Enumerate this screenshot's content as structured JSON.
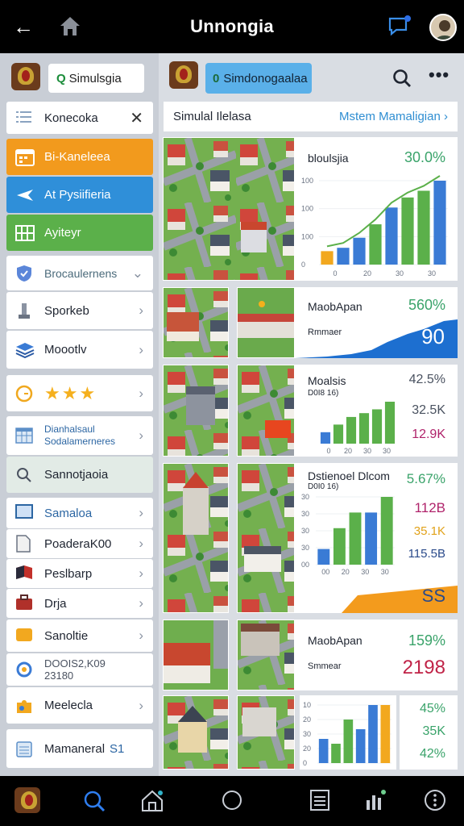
{
  "topbar": {
    "back_icon": "arrow-left-icon",
    "title": "Unnongia"
  },
  "sidebar": {
    "search_prefix": "Q",
    "search_text": "Simulsgia",
    "header_item": {
      "label": "Konecoka"
    },
    "items": [
      {
        "label": "Bi-Kaneleea",
        "color": "#f29a1d"
      },
      {
        "label": "At Pysiifieria",
        "color": "#2f8fd9"
      },
      {
        "label": "Ayiteyr",
        "color": "#5bb04a"
      },
      {
        "label": "Brocaulernens"
      },
      {
        "label": "Sporkeb"
      },
      {
        "label": "Moootlv"
      },
      {
        "label": "★★★"
      },
      {
        "label": "Dianhalsaul",
        "label2": "Sodalamerneres"
      },
      {
        "label": "Sannotjaoia"
      },
      {
        "label": "Samaloa"
      },
      {
        "label": "PoaderaK00"
      },
      {
        "label": "Peslbarp"
      },
      {
        "label": "Drja"
      },
      {
        "label": "Sanoltie"
      },
      {
        "label": "DOOIS2,K09",
        "label2": "23180"
      },
      {
        "label": "Meelecla"
      },
      {
        "label": "Mamaneral",
        "label2": "S1"
      }
    ]
  },
  "main": {
    "search_prefix": "0",
    "search_text": "Simdonogaalaa",
    "sim_bar": {
      "left": "Simulal Ilelasa",
      "right": "Mstem Mamaligian"
    },
    "cards": [
      {
        "title": "bloulsjia",
        "value": "30.0%",
        "value_color": "#3aa36a",
        "axis": [
          "100",
          "100",
          "100",
          "0"
        ],
        "xt": [
          "0",
          "20",
          "30",
          "30"
        ]
      },
      {
        "title": "MaobApan",
        "subtitle": "Rmmaer",
        "value": "560%",
        "value2": "90",
        "value_color": "#3aa36a"
      },
      {
        "title": "Moalsis",
        "subtitle": "D0I8 16)",
        "values": [
          "42.5%",
          "32.5K",
          "12.9K"
        ],
        "value_colors": [
          "#4a5260",
          "#4a5260",
          "#b0236b"
        ],
        "xt": [
          "0",
          "20",
          "30",
          "30"
        ]
      },
      {
        "title": "Dstienoel Dlcom",
        "subtitle": "D0I0 16)",
        "values": [
          "5.67%",
          "112B",
          "35.1K",
          "115.5B",
          "SS"
        ],
        "value_colors": [
          "#3aa36a",
          "#b0236b",
          "#e1a21a",
          "#2a4a8a",
          "#2a4a8a"
        ],
        "axis": [
          "30",
          "30",
          "30",
          "30",
          "00"
        ],
        "xt": [
          "00",
          "20",
          "30",
          "30"
        ]
      },
      {
        "title": "MaobApan",
        "subtitle": "Smmear",
        "value": "159%",
        "value2": "2198",
        "value_color": "#3aa36a",
        "value2_color": "#c02347"
      },
      {
        "axis": [
          "10",
          "20",
          "30",
          "20",
          "0"
        ],
        "values": [
          "45%",
          "35K",
          "42%"
        ],
        "value_colors": [
          "#3aa36a",
          "#3aa36a",
          "#3aa36a"
        ]
      }
    ]
  },
  "chart_data": [
    {
      "type": "bar",
      "title": "bloulsjia",
      "categories": [
        "0",
        "20",
        "30",
        "30"
      ],
      "series": [
        {
          "values": [
            4,
            5,
            8,
            12,
            17,
            20,
            22,
            25
          ]
        }
      ],
      "overlay_line": true
    },
    {
      "type": "area",
      "title": "MaobApan"
    },
    {
      "type": "bar",
      "title": "Moalsis",
      "categories": [
        "0",
        "20",
        "30",
        "30"
      ],
      "series": [
        {
          "values": [
            3,
            5,
            7,
            8,
            9,
            11
          ]
        }
      ]
    },
    {
      "type": "bar",
      "title": "Dstienoel Dlcom",
      "categories": [
        "00",
        "20",
        "30",
        "30"
      ],
      "series": [
        {
          "values": [
            3,
            7,
            10,
            10,
            13
          ]
        }
      ]
    },
    {
      "type": "bar",
      "series": [
        {
          "values": [
            5,
            4,
            9,
            7,
            12,
            12
          ]
        }
      ]
    }
  ]
}
